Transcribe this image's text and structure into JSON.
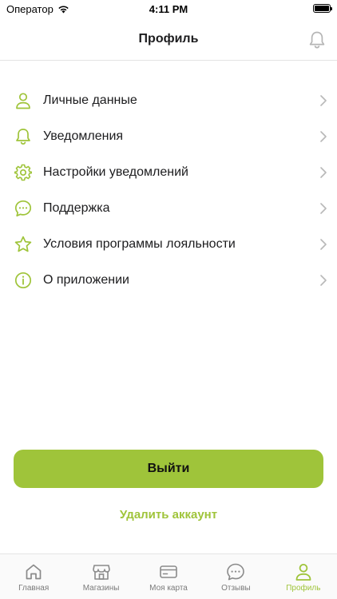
{
  "status_bar": {
    "carrier": "Оператор",
    "time": "4:11 PM"
  },
  "header": {
    "title": "Профиль"
  },
  "menu": [
    {
      "label": "Личные данные",
      "icon": "person-icon"
    },
    {
      "label": "Уведомления",
      "icon": "bell-icon"
    },
    {
      "label": "Настройки уведомлений",
      "icon": "gear-icon"
    },
    {
      "label": "Поддержка",
      "icon": "chat-bubble-icon"
    },
    {
      "label": "Условия программы лояльности",
      "icon": "star-icon"
    },
    {
      "label": "О приложении",
      "icon": "info-icon"
    }
  ],
  "actions": {
    "logout_label": "Выйти",
    "delete_label": "Удалить аккаунт"
  },
  "tabs": [
    {
      "label": "Главная",
      "icon": "home-icon",
      "active": false
    },
    {
      "label": "Магазины",
      "icon": "store-icon",
      "active": false
    },
    {
      "label": "Моя карта",
      "icon": "card-icon",
      "active": false
    },
    {
      "label": "Отзывы",
      "icon": "chat-bubble-icon",
      "active": false
    },
    {
      "label": "Профиль",
      "icon": "person-icon",
      "active": true
    }
  ],
  "colors": {
    "accent": "#9fc43a",
    "text": "#1c1c1e",
    "muted": "#7a7a7a",
    "chevron": "#b8b8b8"
  }
}
